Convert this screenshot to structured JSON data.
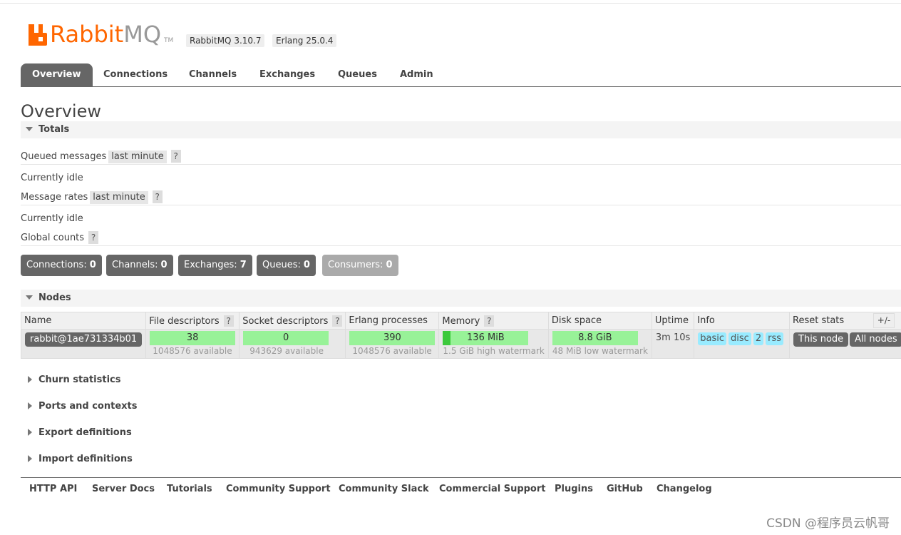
{
  "header": {
    "logo_rabbit": "Rabbit",
    "logo_mq": "MQ",
    "logo_tm": "TM",
    "version_rabbitmq": "RabbitMQ 3.10.7",
    "version_erlang": "Erlang 25.0.4"
  },
  "tabs": [
    {
      "label": "Overview",
      "active": true
    },
    {
      "label": "Connections"
    },
    {
      "label": "Channels"
    },
    {
      "label": "Exchanges"
    },
    {
      "label": "Queues"
    },
    {
      "label": "Admin"
    }
  ],
  "page_title": "Overview",
  "totals": {
    "heading": "Totals",
    "queued_messages_label": "Queued messages",
    "queued_messages_period": "last minute",
    "help": "?",
    "queued_idle": "Currently idle",
    "message_rates_label": "Message rates",
    "message_rates_period": "last minute",
    "rates_idle": "Currently idle",
    "global_counts_label": "Global counts",
    "counts": [
      {
        "label": "Connections:",
        "value": "0"
      },
      {
        "label": "Channels:",
        "value": "0"
      },
      {
        "label": "Exchanges:",
        "value": "7"
      },
      {
        "label": "Queues:",
        "value": "0"
      },
      {
        "label": "Consumers:",
        "value": "0"
      }
    ]
  },
  "nodes": {
    "heading": "Nodes",
    "columns": [
      "Name",
      "File descriptors",
      "Socket descriptors",
      "Erlang processes",
      "Memory",
      "Disk space",
      "Uptime",
      "Info",
      "Reset stats"
    ],
    "help": "?",
    "plusminus": "+/-",
    "row": {
      "name": "rabbit@1ae731334b01",
      "file_descriptors": "38",
      "file_descriptors_available": "1048576 available",
      "socket_descriptors": "0",
      "socket_descriptors_available": "943629 available",
      "erlang_processes": "390",
      "erlang_processes_available": "1048576 available",
      "memory": "136 MiB",
      "memory_watermark": "1.5 GiB high watermark",
      "memory_fraction": 0.09,
      "disk_space": "8.8 GiB",
      "disk_watermark": "48 MiB low watermark",
      "uptime": "3m 10s",
      "info": [
        "basic",
        "disc",
        "2",
        "rss"
      ],
      "reset_this": "This node",
      "reset_all": "All nodes"
    }
  },
  "collapsed_sections": [
    "Churn statistics",
    "Ports and contexts",
    "Export definitions",
    "Import definitions"
  ],
  "footer_links": [
    "HTTP API",
    "Server Docs",
    "Tutorials",
    "Community Support",
    "Community Slack",
    "Commercial Support",
    "Plugins",
    "GitHub",
    "Changelog"
  ],
  "watermark": "CSDN @程序员云帆哥",
  "colors": {
    "brand": "#ff6600",
    "tab_active": "#666666",
    "bar_green": "#98f298",
    "info_blue": "#99ebff"
  }
}
